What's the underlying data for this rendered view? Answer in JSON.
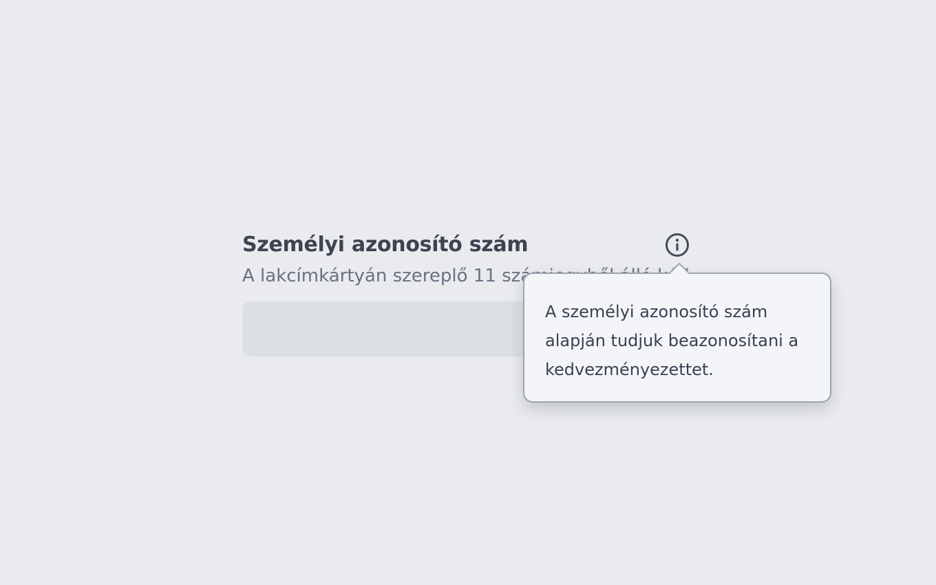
{
  "field": {
    "label": "Személyi azonosító szám",
    "helper_text": "A lakcímkártyán szereplő 11 számjegyből álló kód",
    "input_value": "",
    "info_icon": "info-circle-icon"
  },
  "tooltip": {
    "text": "A személyi azonosító szám alapján tudjuk beazonosítani a kedvezményezettet."
  },
  "colors": {
    "background": "#e9ebef",
    "label": "#3f4350",
    "helper": "#6b7082",
    "input_fill": "#dcdfe4",
    "tooltip_bg": "#f4f5f9",
    "tooltip_border": "#9ea3ae"
  }
}
